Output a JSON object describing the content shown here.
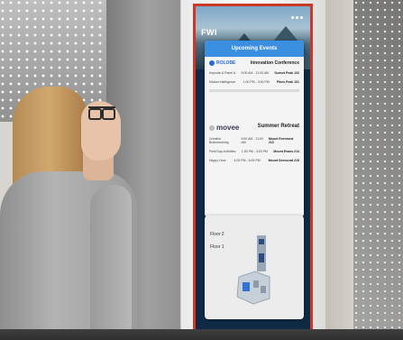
{
  "kiosk": {
    "brand": "FWI",
    "events_header": "Upcoming Events",
    "events": [
      {
        "brand": "ROLOBE",
        "title": "Innovation Conference",
        "sessions": [
          {
            "name": "Keynote & Panel A",
            "time": "9:00 AM - 11:00 AM",
            "place": "Sunset Peak 102"
          },
          {
            "name": "Market Intelligence",
            "time": "1:00 PM - 3:00 PM",
            "place": "Pikes Peak 101"
          }
        ]
      },
      {
        "brand": "movee",
        "title": "Summer Retreat",
        "sessions": [
          {
            "name": "Creative Brainstorming",
            "time": "9:00 AM - 11:00 AM",
            "place": "Mount Evermost 213"
          },
          {
            "name": "Field Day Activities",
            "time": "1:00 PM - 3:00 PM",
            "place": "Mount Evans 214"
          },
          {
            "name": "Happy Hour",
            "time": "4:00 PM - 6:00 PM",
            "place": "Mount Democrat 215"
          }
        ]
      }
    ],
    "map": {
      "floors": [
        "Floor 2",
        "Floor 1"
      ]
    }
  },
  "colors": {
    "accent": "#3b8fe0",
    "frame": "#c73a28",
    "screen_bg": "#0f2a45"
  }
}
